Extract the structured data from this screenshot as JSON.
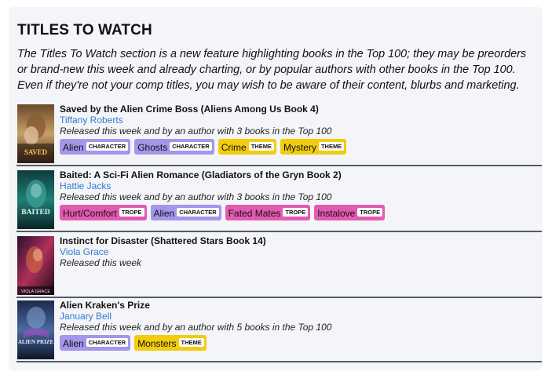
{
  "section": {
    "title": "TITLES TO WATCH",
    "intro": "The Titles To Watch section is a new feature highlighting books in the Top 100; they may be preorders or brand-new this week and already charting, or by popular authors with other books in the Top 100. Even if they're not your comp titles, you may wish to be aware of their content, blurbs and marketing."
  },
  "colors": {
    "character": "#a496ea",
    "theme": "#f2cc0f",
    "trope": "#e35ab1",
    "author_link": "#2f7ad0"
  },
  "books": [
    {
      "title": "Saved by the Alien Crime Boss (Aliens Among Us Book 4)",
      "author": "Tiffany Roberts",
      "note": "Released this week and by an author with 3 books in the Top 100",
      "cover_text": "SAVED",
      "tags": [
        {
          "label": "Alien",
          "kind": "CHARACTER"
        },
        {
          "label": "Ghosts",
          "kind": "CHARACTER"
        },
        {
          "label": "Crime",
          "kind": "THEME"
        },
        {
          "label": "Mystery",
          "kind": "THEME"
        }
      ]
    },
    {
      "title": "Baited: A Sci-Fi Alien Romance (Gladiators of the Gryn Book 2)",
      "author": "Hattie Jacks",
      "note": "Released this week and by an author with 3 books in the Top 100",
      "cover_text": "BAITED",
      "tags": [
        {
          "label": "Hurt/Comfort",
          "kind": "TROPE"
        },
        {
          "label": "Alien",
          "kind": "CHARACTER"
        },
        {
          "label": "Fated Mates",
          "kind": "TROPE"
        },
        {
          "label": "Instalove",
          "kind": "TROPE"
        }
      ]
    },
    {
      "title": "Instinct for Disaster (Shattered Stars Book 14)",
      "author": "Viola Grace",
      "note": "Released this week",
      "cover_text": "VIOLA GRACE",
      "tags": []
    },
    {
      "title": "Alien Kraken's Prize",
      "author": "January Bell",
      "note": "Released this week and by an author with 5 books in the Top 100",
      "cover_text": "ALIEN PRIZE",
      "tags": [
        {
          "label": "Alien",
          "kind": "CHARACTER"
        },
        {
          "label": "Monsters",
          "kind": "THEME"
        }
      ]
    }
  ]
}
